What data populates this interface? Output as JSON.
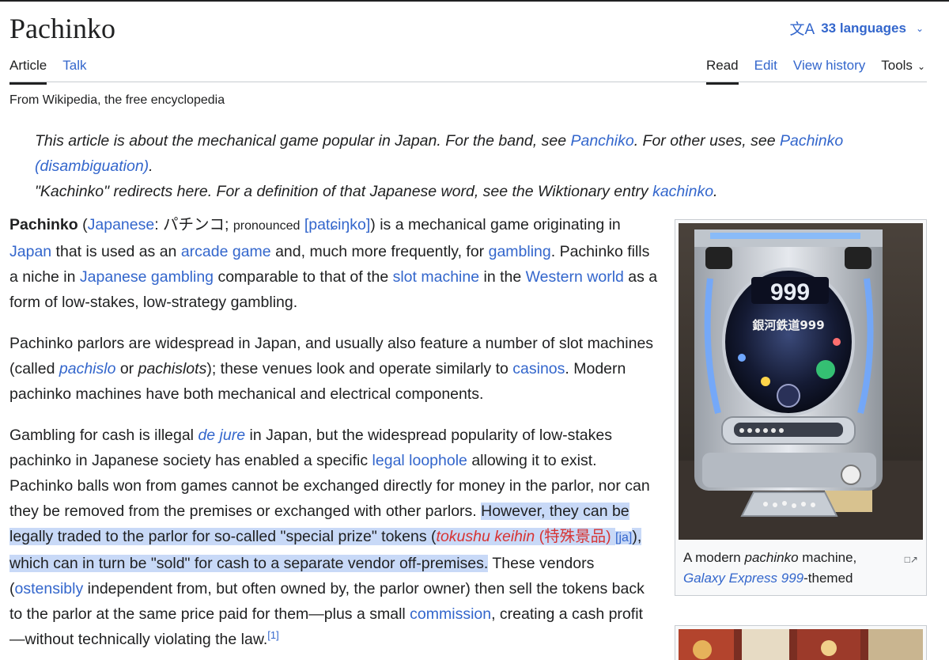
{
  "page": {
    "title": "Pachinko",
    "languages_label": "33 languages",
    "tagline": "From Wikipedia, the free encyclopedia"
  },
  "tabs": {
    "article": "Article",
    "talk": "Talk",
    "read": "Read",
    "edit": "Edit",
    "view_history": "View history",
    "tools": "Tools"
  },
  "hatnote": {
    "line1_a": "This article is about the mechanical game popular in Japan. For the band, see ",
    "line1_link1": "Panchiko",
    "line1_b": ". For other uses, see ",
    "line1_link2": "Pachinko (disambiguation)",
    "line1_c": ".",
    "line2_a": "\"Kachinko\" redirects here. For a definition of that Japanese word, see the Wiktionary entry ",
    "line2_link": "kachinko",
    "line2_b": "."
  },
  "para1": {
    "bold": "Pachinko",
    "t1": " (",
    "l_japanese": "Japanese",
    "t2": ": パチンコ; ",
    "pronounced": "pronounced",
    "t3": " ",
    "l_ipa": "[patɕiŋko]",
    "t4": ") is a mechanical game originating in ",
    "l_japan": "Japan",
    "t5": " that is used as an ",
    "l_arcade": "arcade game",
    "t6": " and, much more frequently, for ",
    "l_gambling": "gambling",
    "t7": ". Pachinko fills a niche in ",
    "l_jgambling": "Japanese gambling",
    "t8": " comparable to that of the ",
    "l_slot": "slot machine",
    "t9": " in the ",
    "l_western": "Western world",
    "t10": " as a form of low-stakes, low-strategy gambling."
  },
  "para2": {
    "t1": "Pachinko parlors are widespread in Japan, and usually also feature a number of slot machines (called ",
    "l_pachislo": "pachislo",
    "t2": " or ",
    "i_pachislots": "pachislots",
    "t3": "); these venues look and operate similarly to ",
    "l_casinos": "casinos",
    "t4": ". Modern pachinko machines have both mechanical and electrical components."
  },
  "para3": {
    "t1": "Gambling for cash is illegal ",
    "l_dejure": "de jure",
    "t2": " in Japan, but the widespread popularity of low-stakes pachinko in Japanese society has enabled a specific ",
    "l_loophole": "legal loophole",
    "t3": " allowing it to exist. Pachinko balls won from games cannot be exchanged directly for money in the parlor, nor can they be removed from the premises or exchanged with other parlors. ",
    "hl1": "However, they can be legally traded to the parlor for so-called \"special prize\" tokens (",
    "r_tokushu": "tokushu keihin",
    "r_kanji": " (特殊景品)",
    "hl2": " ",
    "l_ja": "[ja]",
    "hl3": "), which can in turn be \"sold\" for cash to a separate vendor off-premises.",
    "t4": " These vendors (",
    "l_ostensibly": "ostensibly",
    "t5": " independent from, but often owned by, the parlor owner) then sell the tokens back to the parlor at the same price paid for them—plus a small ",
    "l_commission": "commission",
    "t6": ", creating a cash profit —without technically violating the law.",
    "ref": "[1]"
  },
  "infobox": {
    "caption_a": "A modern ",
    "caption_italic": "pachinko",
    "caption_b": " machine,",
    "caption_link": "Galaxy Express 999",
    "caption_c": "-themed",
    "machine_number": "999",
    "machine_logo": "銀河鉄道999"
  },
  "colors": {
    "link": "#3366cc",
    "redlink": "#d73333",
    "highlight": "#c8d9f7",
    "text": "#202122",
    "border": "#c8ccd1"
  },
  "icons": {
    "language": "translate-icon",
    "dropdown": "chevron-down-icon",
    "enlarge": "enlarge-icon"
  }
}
